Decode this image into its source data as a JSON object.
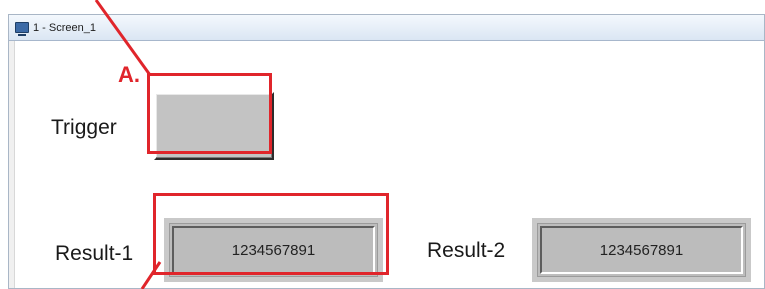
{
  "window": {
    "title": "1 - Screen_1",
    "icon": "screen-icon"
  },
  "trigger": {
    "label": "Trigger"
  },
  "result1": {
    "label": "Result-1",
    "value": "1234567891"
  },
  "result2": {
    "label": "Result-2",
    "value": "1234567891"
  },
  "annotations": {
    "a_label": "A.",
    "color": "#e0252b"
  }
}
